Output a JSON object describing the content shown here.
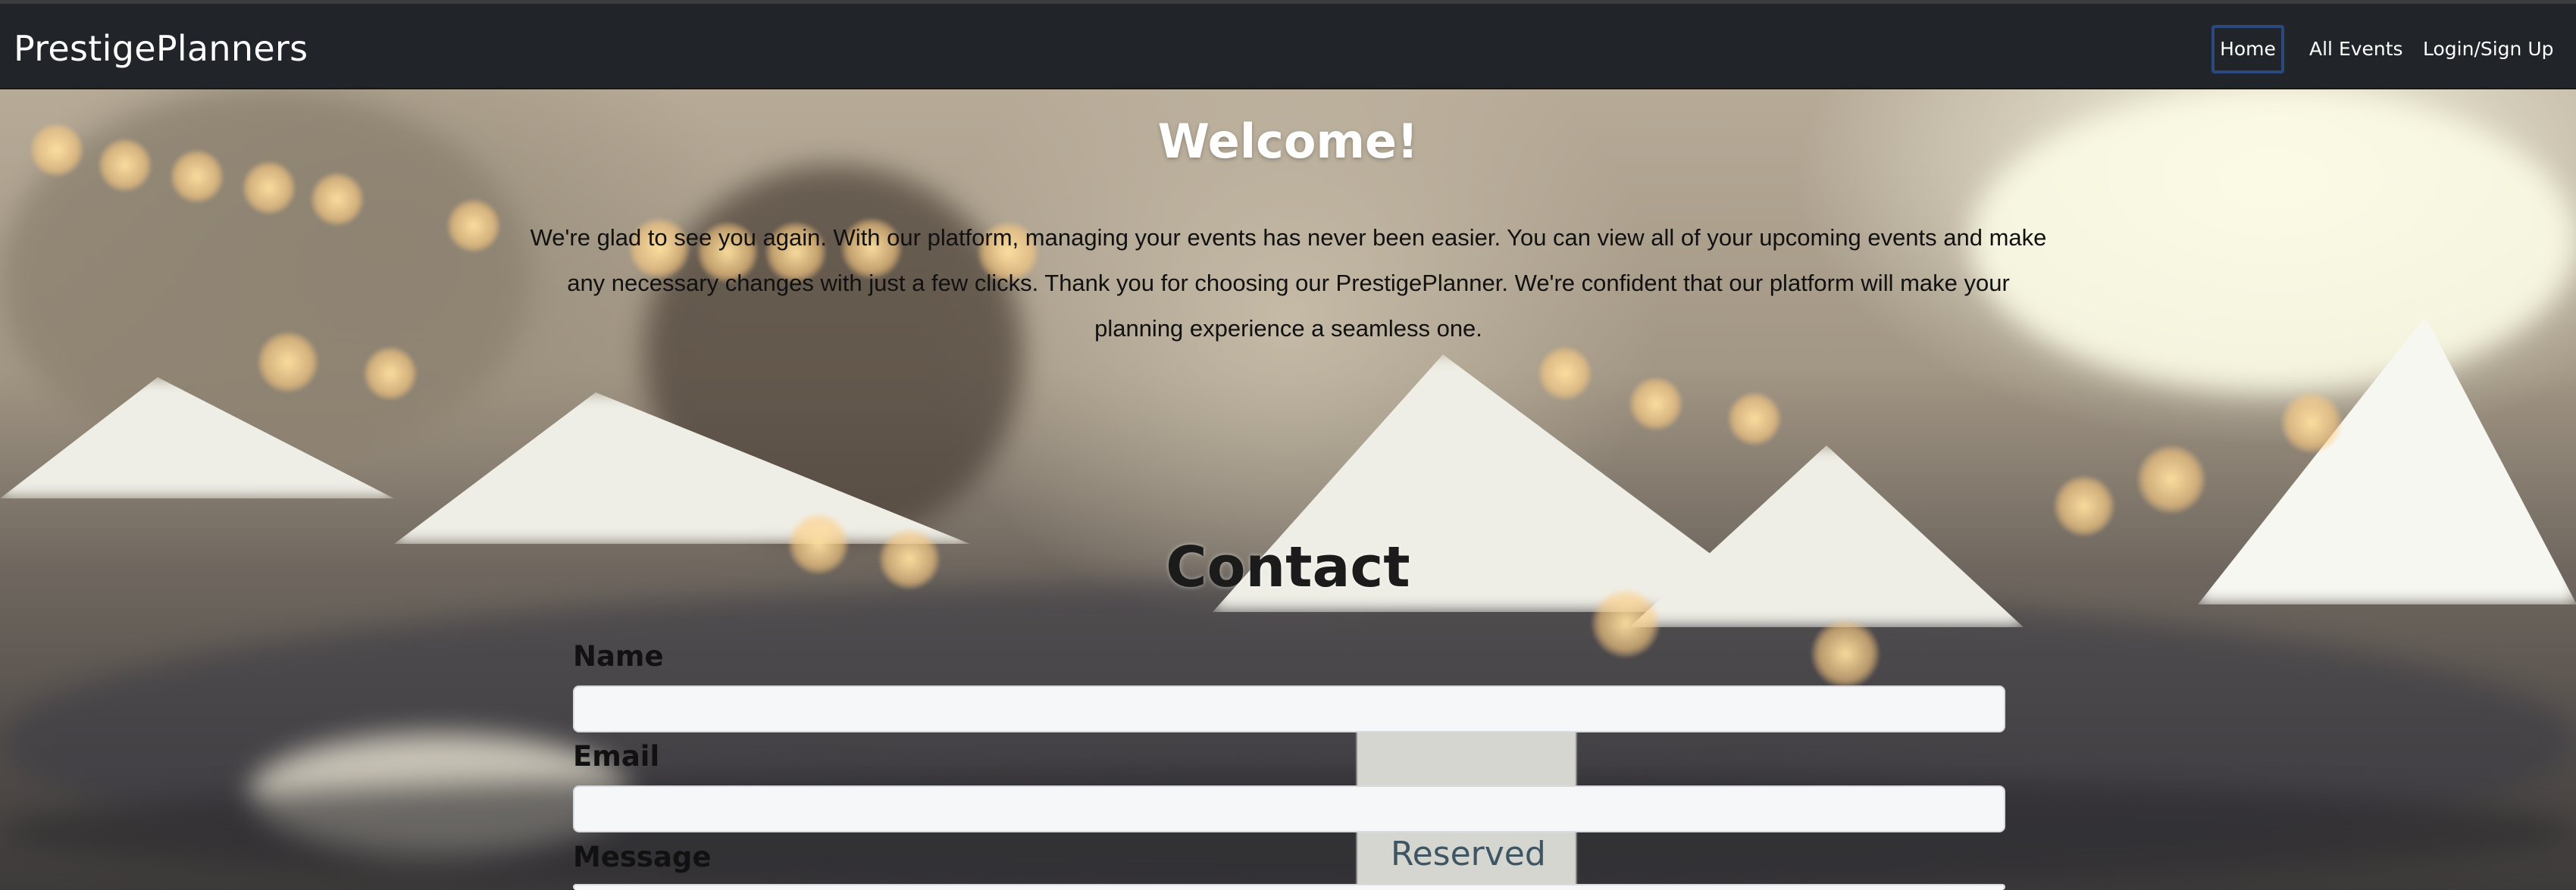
{
  "navbar": {
    "brand": "PrestigePlanners",
    "links": [
      {
        "label": "Home",
        "active": true
      },
      {
        "label": "All Events",
        "active": false
      },
      {
        "label": "Login/Sign Up",
        "active": false
      }
    ]
  },
  "welcome": {
    "title": "Welcome!",
    "text": "We're glad to see you again. With our platform, managing your events has never been easier. You can view all of your upcoming events and make any necessary changes with just a few clicks. Thank you for choosing our PrestigePlanner. We're confident that our platform will make your planning experience a seamless one."
  },
  "contact": {
    "title": "Contact",
    "name_label": "Name",
    "name_value": "",
    "email_label": "Email",
    "email_value": "",
    "message_label": "Message"
  },
  "background": {
    "sign_text": "Reserved"
  },
  "colors": {
    "navbar": "#212529",
    "active_border": "#2a4a7f",
    "input_bg": "#f6f7f9"
  }
}
